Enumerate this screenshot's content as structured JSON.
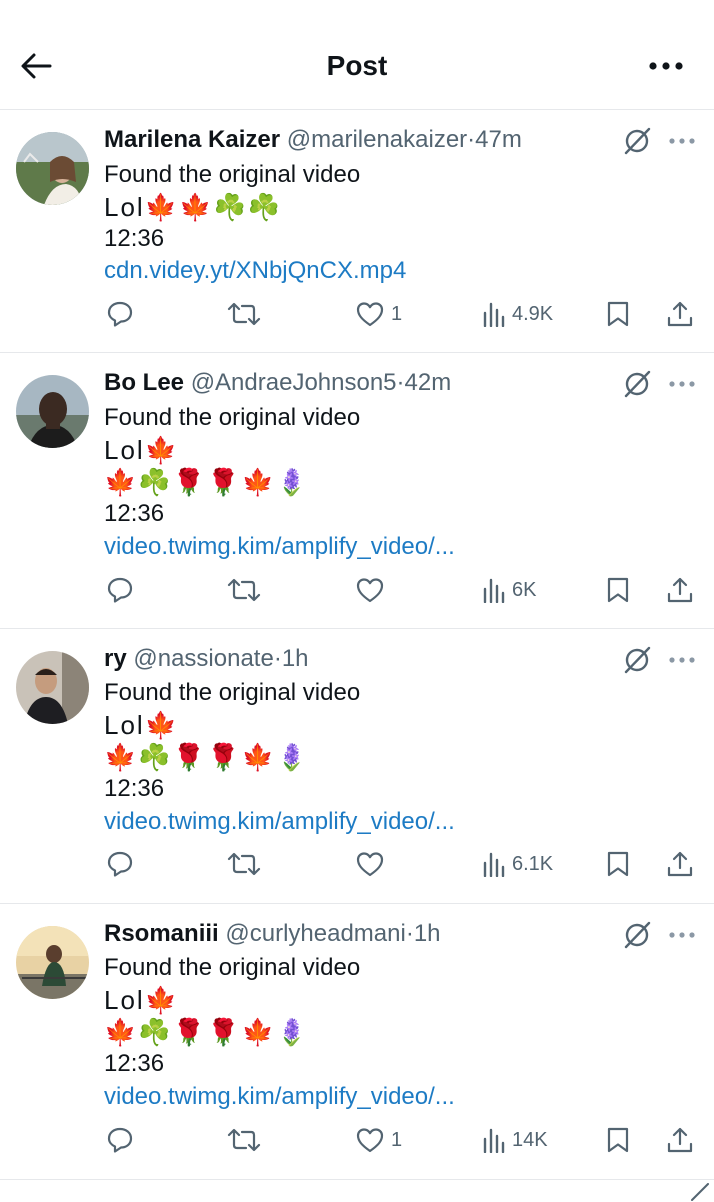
{
  "header": {
    "title": "Post",
    "back_icon": "arrow-left-icon",
    "more_icon": "more-horizontal-icon"
  },
  "replies": [
    {
      "name": "Marilena Kaizer",
      "handle": "@marilenakaizer",
      "dot": "·",
      "time": "47m",
      "line1": "Found the original video",
      "line2": "Lol🍁🍁☘️☘️",
      "line3": "",
      "line4": "12:36",
      "link": "cdn.videy.yt/XNbjQnCX.mp4",
      "stats": {
        "replies": "",
        "reposts": "",
        "likes": "1",
        "views": "4.9K"
      }
    },
    {
      "name": "Bo Lee",
      "handle": "@AndraeJohnson5",
      "dot": "·",
      "time": "42m",
      "line1": "Found the original video",
      "line2": "Lol🍁",
      "line3": "🍁☘️🌹🌹🍁🪻",
      "line4": "12:36",
      "link": "video.twimg.kim/amplify_video/...",
      "stats": {
        "replies": "",
        "reposts": "",
        "likes": "",
        "views": "6K"
      }
    },
    {
      "name": "ry",
      "handle": "@nassionate",
      "dot": "·",
      "time": "1h",
      "line1": "Found the original video",
      "line2": "Lol🍁",
      "line3": "🍁☘️🌹🌹🍁🪻",
      "line4": "12:36",
      "link": "video.twimg.kim/amplify_video/...",
      "stats": {
        "replies": "",
        "reposts": "",
        "likes": "",
        "views": "6.1K"
      }
    },
    {
      "name": "Rsomaniii",
      "handle": "@curlyheadmani",
      "dot": "·",
      "time": "1h",
      "line1": "Found the original video",
      "line2": "Lol🍁",
      "line3": "🍁☘️🌹🌹🍁🪻",
      "line4": "12:36",
      "link": "video.twimg.kim/amplify_video/...",
      "stats": {
        "replies": "",
        "reposts": "",
        "likes": "1",
        "views": "14K"
      }
    }
  ],
  "colors": {
    "link": "#1d7bc4",
    "muted": "#536471",
    "text": "#0f1419",
    "divider": "#e6e8eb"
  }
}
